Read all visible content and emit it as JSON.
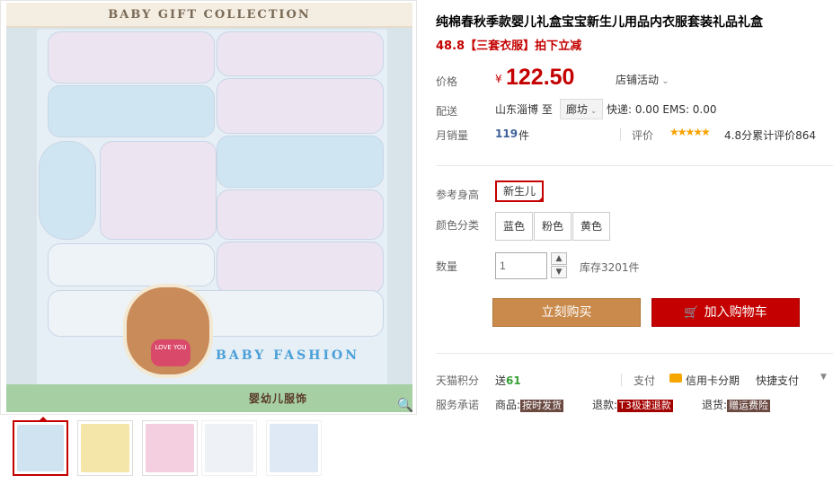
{
  "gallery": {
    "box_title": "BABY GIFT COLLECTION",
    "box_footer": "婴幼儿服饰",
    "brand_text": "BABY FASHION",
    "bear_heart": "LOVE YOU",
    "zoom_icon": "magnifier-icon",
    "thumbnails": [
      {
        "color": "#cfe3f0",
        "selected": true
      },
      {
        "color": "#f3e6a8",
        "selected": false
      },
      {
        "color": "#f3cfe0",
        "selected": false
      },
      {
        "color": "#eef1f6",
        "selected": false
      },
      {
        "color": "#dfe9f5",
        "selected": false
      }
    ]
  },
  "product": {
    "title": "纯棉春秋季款婴儿礼盒宝宝新生儿用品内衣服套装礼品礼盒",
    "subtitle": "48.8【三套衣服】拍下立减",
    "price_label": "价格",
    "currency": "¥",
    "price": "122.50",
    "promo": "店铺活动",
    "shipping_label": "配送",
    "ship_from": "山东淄博",
    "ship_to_prefix": "至",
    "ship_to": "廊坊",
    "ship_fee": "快递: 0.00 EMS: 0.00",
    "sales_label": "月销量",
    "sales_count": "119",
    "sales_unit": "件",
    "rating_label": "评价",
    "stars": "★★★★★",
    "rating_text": "4.8分累计评价864",
    "height_label": "参考身高",
    "height_option": "新生儿",
    "color_label": "颜色分类",
    "colors": [
      "蓝色",
      "粉色",
      "黄色"
    ],
    "qty_label": "数量",
    "qty_value": "1",
    "qty_up": "▲",
    "qty_down": "▼",
    "stock": "库存3201件",
    "buy_now": "立刻购买",
    "add_cart": "加入购物车",
    "points_label": "天猫积分",
    "points_prefix": "送",
    "points_value": "61",
    "pay_label": "支付",
    "pay_option1": "信用卡分期",
    "pay_option2": "快捷支付",
    "service_label": "服务承诺",
    "svc1_prefix": "商品:",
    "svc1_tag": "按时发货",
    "svc2_prefix": "退款:",
    "svc2_tag": "T3极速退款",
    "svc3_prefix": "退货:",
    "svc3_tag": "赠运费险"
  }
}
